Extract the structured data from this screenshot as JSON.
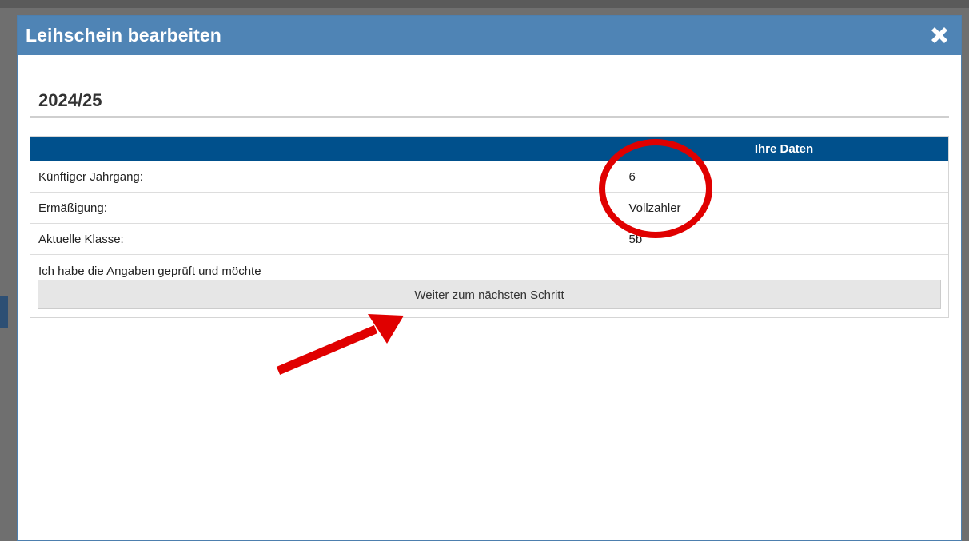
{
  "dialog": {
    "title": "Leihschein bearbeiten",
    "close_icon": "close-x-icon",
    "header_color": "#4f84b5"
  },
  "section": {
    "heading": "2024/25"
  },
  "table": {
    "header_color": "#00508c",
    "columns": [
      "",
      "Ihre Daten"
    ],
    "rows": [
      {
        "label": "Künftiger Jahrgang:",
        "value": "6"
      },
      {
        "label": "Ermäßigung:",
        "value": "Vollzahler"
      },
      {
        "label": "Aktuelle Klasse:",
        "value": "5b"
      }
    ]
  },
  "confirm": {
    "text": "Ich habe die Angaben geprüft und möchte",
    "button_label": "Weiter zum nächsten Schritt"
  },
  "annotations": {
    "color": "#e00000",
    "items": [
      "red-circle-around-values",
      "red-arrow-pointing-to-button"
    ]
  }
}
